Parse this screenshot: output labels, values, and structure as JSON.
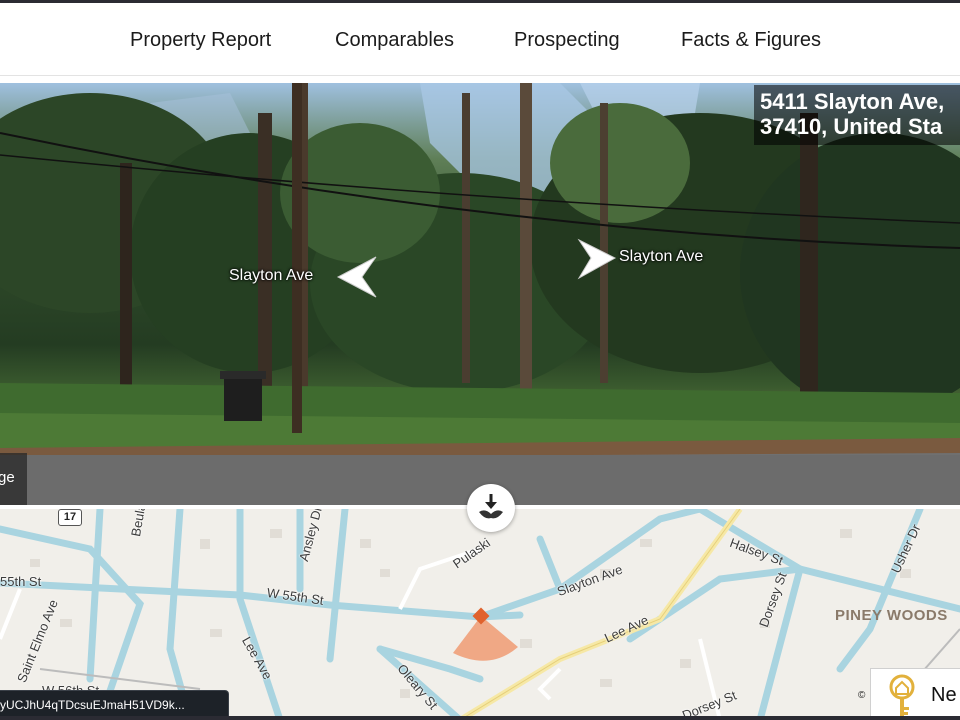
{
  "nav": {
    "items": [
      {
        "label": "Property Report"
      },
      {
        "label": "Comparables"
      },
      {
        "label": "Prospecting"
      },
      {
        "label": "Facts & Figures"
      }
    ]
  },
  "street_view": {
    "address_line1": "5411 Slayton Ave,",
    "address_line2": "37410, United Sta",
    "left_street_label": "Slayton Ave",
    "right_street_label": "Slayton Ave",
    "edge_text": "ge"
  },
  "map": {
    "route_shield": "17",
    "labels": {
      "w55_left": "55th St",
      "beulah": "Beulah Ave",
      "ansley": "Ansley Dr",
      "pulaski": "Pulaski",
      "slayton": "Slayton Ave",
      "halsey": "Halsey St",
      "usher": "Usher Dr",
      "w55_mid": "W 55th St",
      "saint_elmo": "Saint Elmo Ave",
      "lee_ave_left": "Lee Ave",
      "lee_ave_right": "Lee Ave",
      "dorsey_top": "Dorsey St",
      "dorsey_bottom": "Dorsey St",
      "oleary": "Oleary St",
      "w56": "W 56th St"
    },
    "district": "PINEY WOODS",
    "copyright": "©",
    "marker_color": "#e0622d",
    "view_cone_color": "#f0a07a"
  },
  "promo": {
    "text": "Ne"
  },
  "status_bar": {
    "url_text": "yUCJhU4qTDcsuEJmaH51VD9k..."
  }
}
